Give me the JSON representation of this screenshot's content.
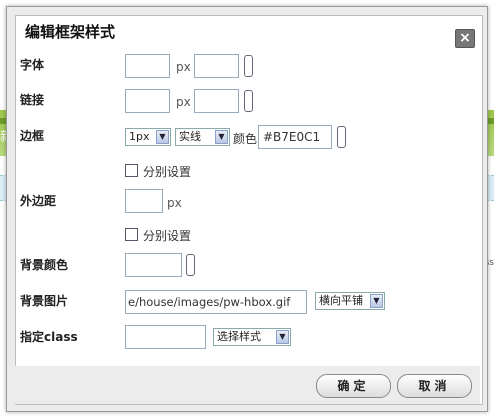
{
  "dialog": {
    "title": "编辑框架样式",
    "close_glyph": "×"
  },
  "background": {
    "left_text": "新彡",
    "right_text": "ess"
  },
  "font": {
    "label": "字体",
    "size_value": "",
    "unit": "px",
    "color_value": ""
  },
  "link": {
    "label": "链接",
    "size_value": "",
    "unit": "px",
    "color_value": ""
  },
  "border": {
    "label": "边框",
    "width_select": "1px",
    "style_select": "实线",
    "color_label": "颜色",
    "color_value": "#B7E0C1",
    "separate_label": "分别设置"
  },
  "margin": {
    "label": "外边距",
    "value": "",
    "unit": "px",
    "separate_label": "分别设置"
  },
  "bg_color": {
    "label": "背景颜色",
    "value": ""
  },
  "bg_image": {
    "label": "背景图片",
    "value": "e/house/images/pw-hbox.gif",
    "repeat_select": "横向平铺"
  },
  "css_class": {
    "label": "指定class",
    "value": "",
    "style_select": "选择样式"
  },
  "buttons": {
    "ok": "确定",
    "cancel": "取消"
  }
}
